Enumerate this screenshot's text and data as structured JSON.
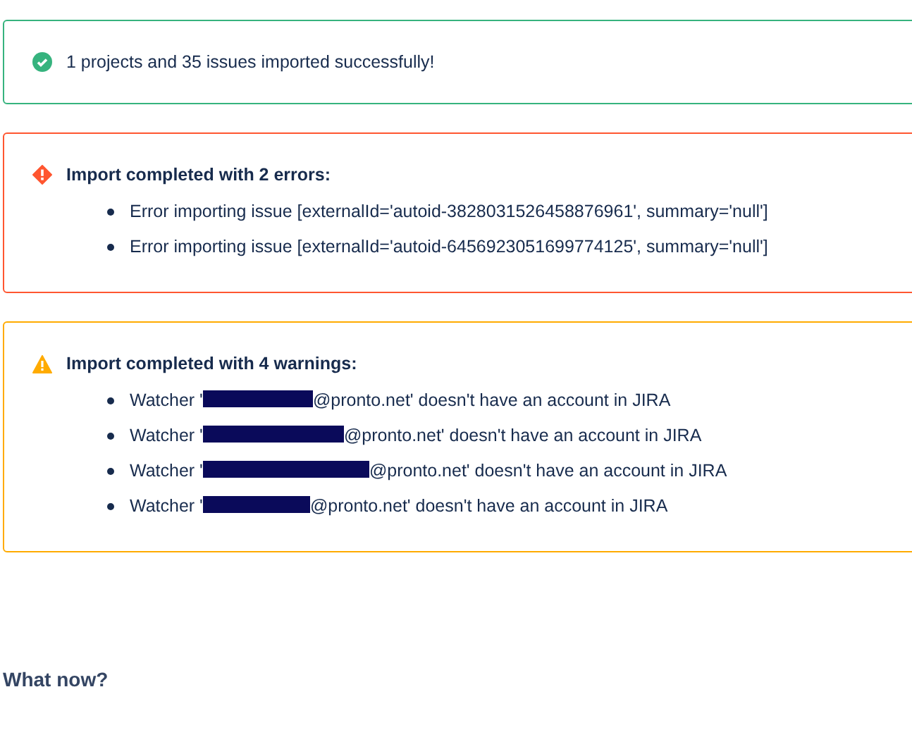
{
  "messages": [
    {
      "kind": "success",
      "title": "1 projects and 35 issues imported successfully!"
    },
    {
      "kind": "error",
      "title": "Import completed with 2 errors:",
      "items": [
        {
          "before": "Error importing issue [externalId='autoid-3828031526458876961', summary='null']"
        },
        {
          "before": "Error importing issue [externalId='autoid-6456923051699774125', summary='null']"
        }
      ]
    },
    {
      "kind": "warning",
      "title": "Import completed with 4 warnings:",
      "items": [
        {
          "before": "Watcher '",
          "redacted": true,
          "after": "@pronto.net' doesn't have an account in JIRA"
        },
        {
          "before": "Watcher '",
          "redacted": true,
          "after": "@pronto.net' doesn't have an account in JIRA"
        },
        {
          "before": "Watcher '",
          "redacted": true,
          "after": "@pronto.net' doesn't have an account in JIRA"
        },
        {
          "before": "Watcher '",
          "redacted": true,
          "after": "@pronto.net' doesn't have an account in JIRA"
        }
      ]
    }
  ],
  "next_heading": "What now?"
}
